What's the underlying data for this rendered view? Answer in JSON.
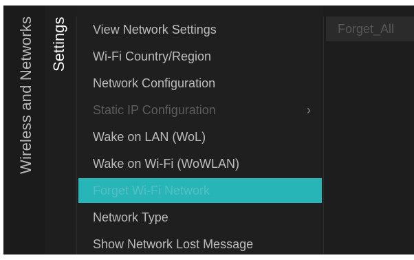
{
  "breadcrumb": {
    "parent": "Wireless and Networks",
    "current": "Settings"
  },
  "menu": {
    "items": [
      {
        "label": "View Network Settings",
        "state": "normal"
      },
      {
        "label": "Wi-Fi Country/Region",
        "state": "normal"
      },
      {
        "label": "Network Configuration",
        "state": "normal"
      },
      {
        "label": "Static IP Configuration",
        "state": "disabled",
        "chevron": "›"
      },
      {
        "label": "Wake on LAN (WoL)",
        "state": "normal"
      },
      {
        "label": "Wake on Wi-Fi (WoWLAN)",
        "state": "normal"
      },
      {
        "label": "Forget Wi-Fi Network",
        "state": "selected"
      },
      {
        "label": "Network Type",
        "state": "normal"
      },
      {
        "label": "Show Network Lost Message",
        "state": "normal"
      }
    ]
  },
  "submenu": {
    "option_label": "Forget_All"
  },
  "colors": {
    "background": "#1f1f1f",
    "highlight": "#27b5b8",
    "text": "#bdbdbd",
    "disabled_text": "#5c5c5c"
  },
  "icons": {
    "static_ip_chevron": "chevron-right-icon"
  }
}
